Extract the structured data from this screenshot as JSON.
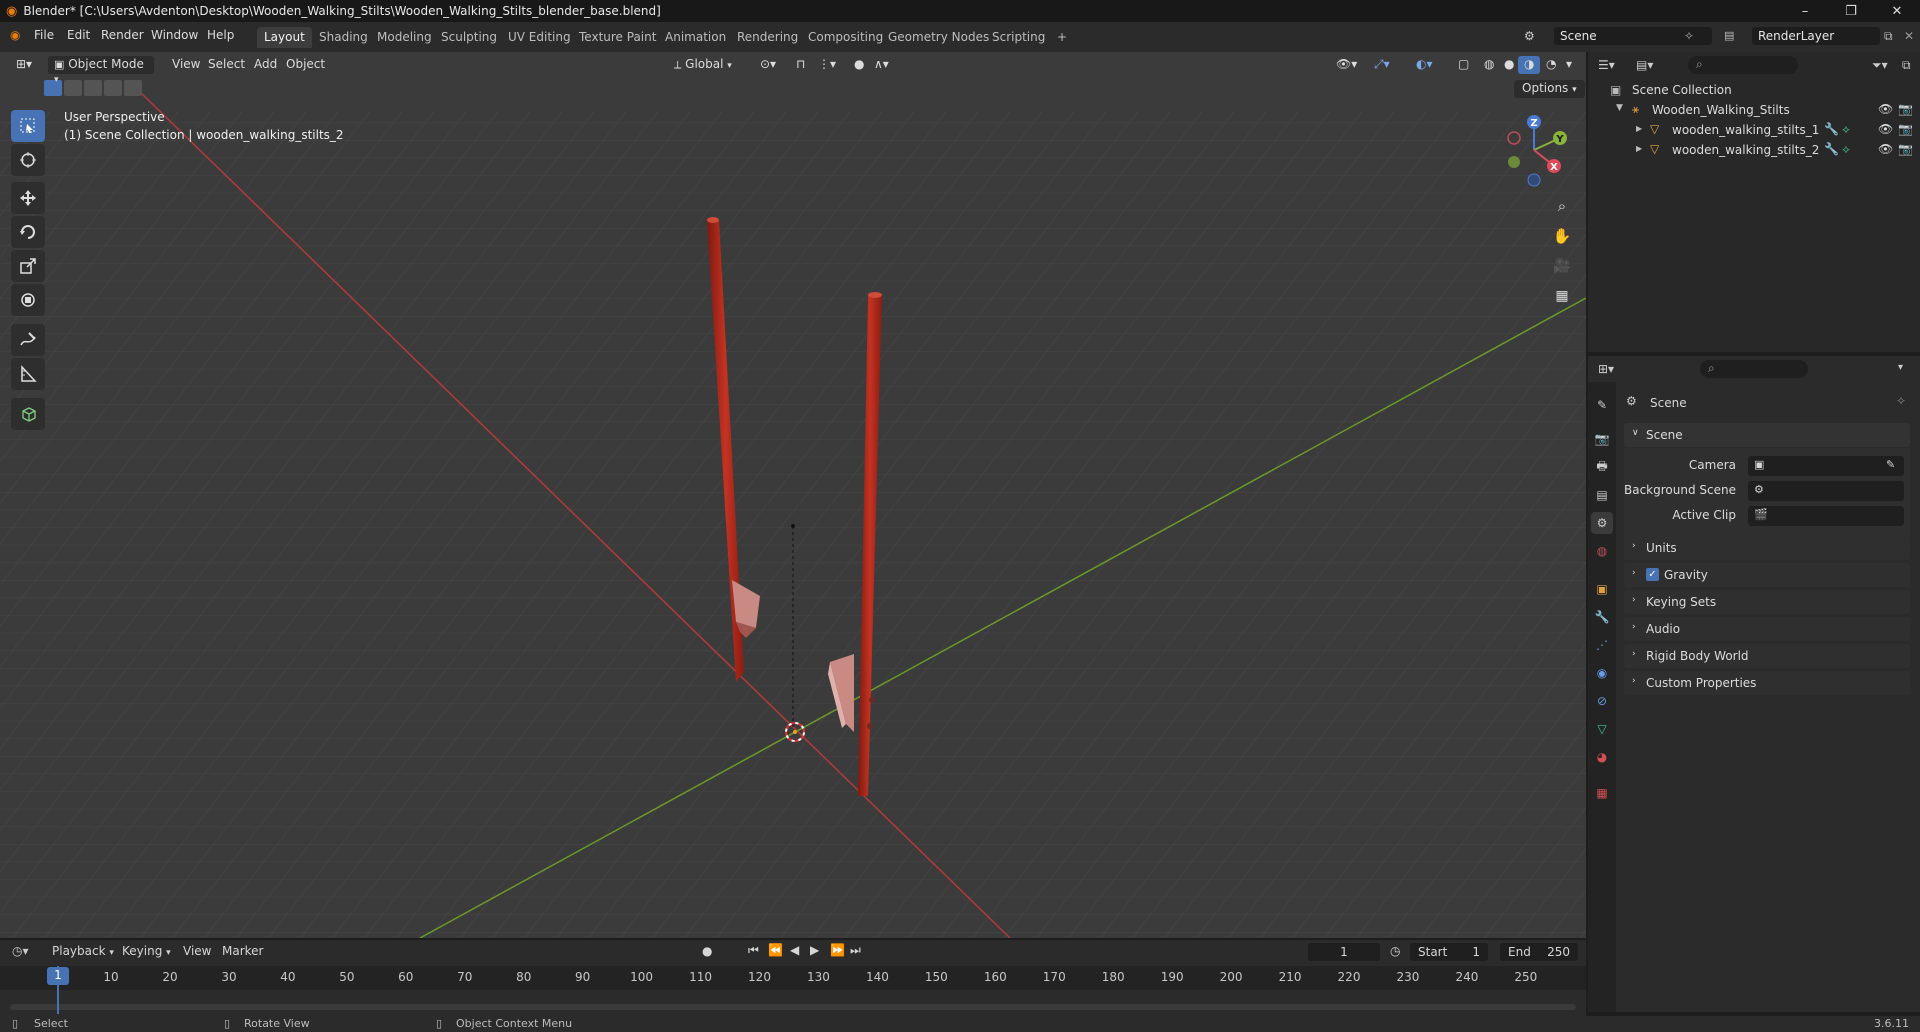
{
  "window": {
    "title": "Blender* [C:\\Users\\Avdenton\\Desktop\\Wooden_Walking_Stilts\\Wooden_Walking_Stilts_blender_base.blend]",
    "minimize": "–",
    "maximize": "❐",
    "close": "✕"
  },
  "menu": {
    "file": "File",
    "edit": "Edit",
    "render": "Render",
    "window": "Window",
    "help": "Help"
  },
  "workspaces": [
    "Layout",
    "Shading",
    "Modeling",
    "Sculpting",
    "UV Editing",
    "Texture Paint",
    "Animation",
    "Rendering",
    "Compositing",
    "Geometry Nodes",
    "Scripting"
  ],
  "active_workspace": "Layout",
  "add_workspace": "+",
  "scene_field": "Scene",
  "render_layer_field": "RenderLayer",
  "viewport_header": {
    "mode": "Object Mode",
    "view": "View",
    "select": "Select",
    "add": "Add",
    "object": "Object",
    "orientation": "Global",
    "options": "Options"
  },
  "viewport_overlay": {
    "perspective": "User Perspective",
    "collection_info": "(1) Scene Collection | wooden_walking_stilts_2"
  },
  "gizmo": {
    "z": "Z",
    "y": "Y",
    "x": "X"
  },
  "outliner": {
    "root": "Scene Collection",
    "collection": "Wooden_Walking_Stilts",
    "objects": [
      "wooden_walking_stilts_1",
      "wooden_walking_stilts_2"
    ]
  },
  "properties": {
    "context_title": "Scene",
    "scene_panel": "Scene",
    "camera_label": "Camera",
    "background_scene_label": "Background Scene",
    "active_clip_label": "Active Clip",
    "panels": [
      "Units",
      "Gravity",
      "Keying Sets",
      "Audio",
      "Rigid Body World",
      "Custom Properties"
    ],
    "gravity_checked": true
  },
  "timeline": {
    "playback": "Playback",
    "keying": "Keying",
    "view": "View",
    "marker": "Marker",
    "current_frame": "1",
    "start_label": "Start",
    "start": "1",
    "end_label": "End",
    "end": "250",
    "ticks": [
      "10",
      "20",
      "30",
      "40",
      "50",
      "60",
      "70",
      "80",
      "90",
      "100",
      "110",
      "120",
      "130",
      "140",
      "150",
      "160",
      "170",
      "180",
      "190",
      "200",
      "210",
      "220",
      "230",
      "240",
      "250"
    ],
    "playhead_label": "1"
  },
  "statusbar": {
    "select": "Select",
    "rotate": "Rotate View",
    "context_menu": "Object Context Menu",
    "version": "3.6.11"
  },
  "colors": {
    "accent": "#4772b3",
    "stilt": "#b8291a",
    "x_axis": "#b33a3a",
    "y_axis": "#6a9a2a"
  }
}
